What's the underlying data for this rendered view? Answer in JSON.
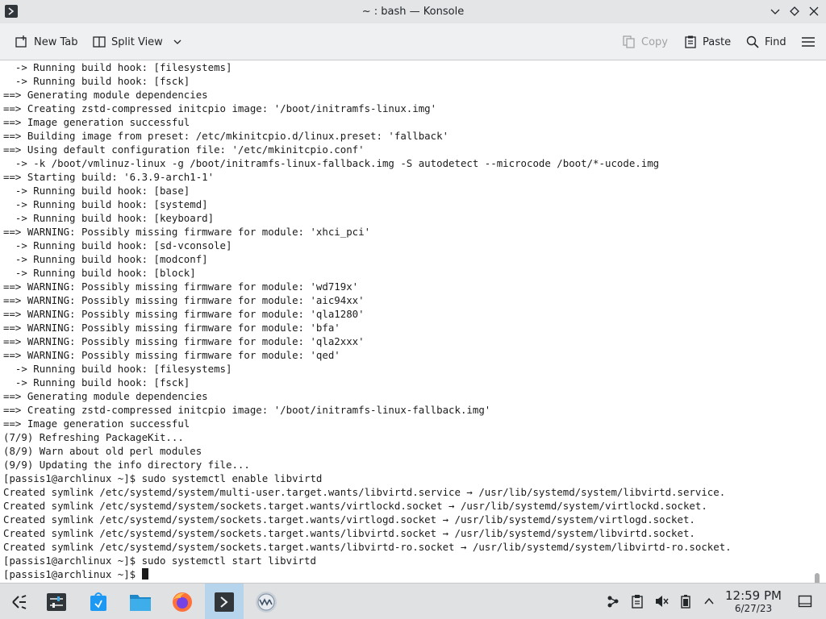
{
  "window": {
    "title": "~ : bash — Konsole"
  },
  "toolbar": {
    "new_tab": "New Tab",
    "split_view": "Split View",
    "copy": "Copy",
    "paste": "Paste",
    "find": "Find"
  },
  "terminal": {
    "lines": [
      "  -> Running build hook: [filesystems]",
      "  -> Running build hook: [fsck]",
      "==> Generating module dependencies",
      "==> Creating zstd-compressed initcpio image: '/boot/initramfs-linux.img'",
      "==> Image generation successful",
      "==> Building image from preset: /etc/mkinitcpio.d/linux.preset: 'fallback'",
      "==> Using default configuration file: '/etc/mkinitcpio.conf'",
      "  -> -k /boot/vmlinuz-linux -g /boot/initramfs-linux-fallback.img -S autodetect --microcode /boot/*-ucode.img",
      "==> Starting build: '6.3.9-arch1-1'",
      "  -> Running build hook: [base]",
      "  -> Running build hook: [systemd]",
      "  -> Running build hook: [keyboard]",
      "==> WARNING: Possibly missing firmware for module: 'xhci_pci'",
      "  -> Running build hook: [sd-vconsole]",
      "  -> Running build hook: [modconf]",
      "  -> Running build hook: [block]",
      "==> WARNING: Possibly missing firmware for module: 'wd719x'",
      "==> WARNING: Possibly missing firmware for module: 'aic94xx'",
      "==> WARNING: Possibly missing firmware for module: 'qla1280'",
      "==> WARNING: Possibly missing firmware for module: 'bfa'",
      "==> WARNING: Possibly missing firmware for module: 'qla2xxx'",
      "==> WARNING: Possibly missing firmware for module: 'qed'",
      "  -> Running build hook: [filesystems]",
      "  -> Running build hook: [fsck]",
      "==> Generating module dependencies",
      "==> Creating zstd-compressed initcpio image: '/boot/initramfs-linux-fallback.img'",
      "==> Image generation successful",
      "(7/9) Refreshing PackageKit...",
      "(8/9) Warn about old perl modules",
      "(9/9) Updating the info directory file...",
      "[passis1@archlinux ~]$ sudo systemctl enable libvirtd",
      "Created symlink /etc/systemd/system/multi-user.target.wants/libvirtd.service → /usr/lib/systemd/system/libvirtd.service.",
      "Created symlink /etc/systemd/system/sockets.target.wants/virtlockd.socket → /usr/lib/systemd/system/virtlockd.socket.",
      "Created symlink /etc/systemd/system/sockets.target.wants/virtlogd.socket → /usr/lib/systemd/system/virtlogd.socket.",
      "Created symlink /etc/systemd/system/sockets.target.wants/libvirtd.socket → /usr/lib/systemd/system/libvirtd.socket.",
      "Created symlink /etc/systemd/system/sockets.target.wants/libvirtd-ro.socket → /usr/lib/systemd/system/libvirtd-ro.socket.",
      "[passis1@archlinux ~]$ sudo systemctl start libvirtd"
    ],
    "prompt": "[passis1@archlinux ~]$ "
  },
  "taskbar": {
    "items": [
      {
        "icon": "application-launcher-icon"
      },
      {
        "icon": "system-settings-icon"
      },
      {
        "icon": "discover-store-icon"
      },
      {
        "icon": "file-manager-icon"
      },
      {
        "icon": "firefox-icon"
      },
      {
        "icon": "konsole-icon"
      },
      {
        "icon": "virt-manager-icon"
      }
    ],
    "tray": [
      {
        "icon": "network-icon"
      },
      {
        "icon": "clipboard-icon"
      },
      {
        "icon": "volume-muted-icon"
      },
      {
        "icon": "battery-icon"
      },
      {
        "icon": "expand-tray-icon"
      }
    ],
    "clock_time": "12:59 PM",
    "clock_date": "6/27/23"
  },
  "colors": {
    "terminal_bg": "#ffffff",
    "terminal_fg": "#1b1b1b",
    "active_task": "#b6d4ec"
  }
}
